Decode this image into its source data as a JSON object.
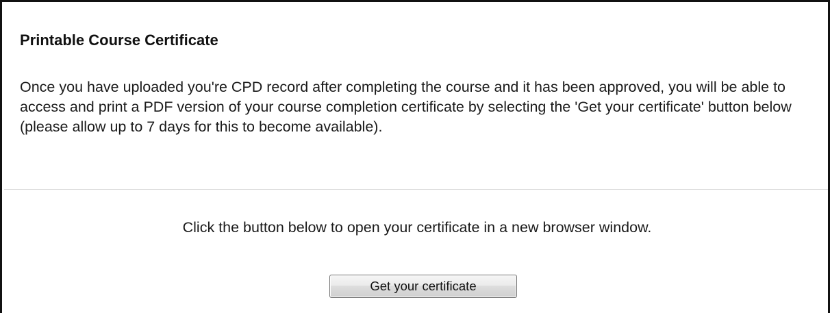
{
  "certificate_section": {
    "title": "Printable Course Certificate",
    "description": "Once you have uploaded you're CPD record after completing the course and it has been approved, you will be able to access and print a PDF version of your course completion certificate by selecting the 'Get your certificate' button below (please allow up to 7 days for this to become available).",
    "instruction": "Click the button below to open your certificate in a new browser window.",
    "button_label": "Get your certificate"
  }
}
